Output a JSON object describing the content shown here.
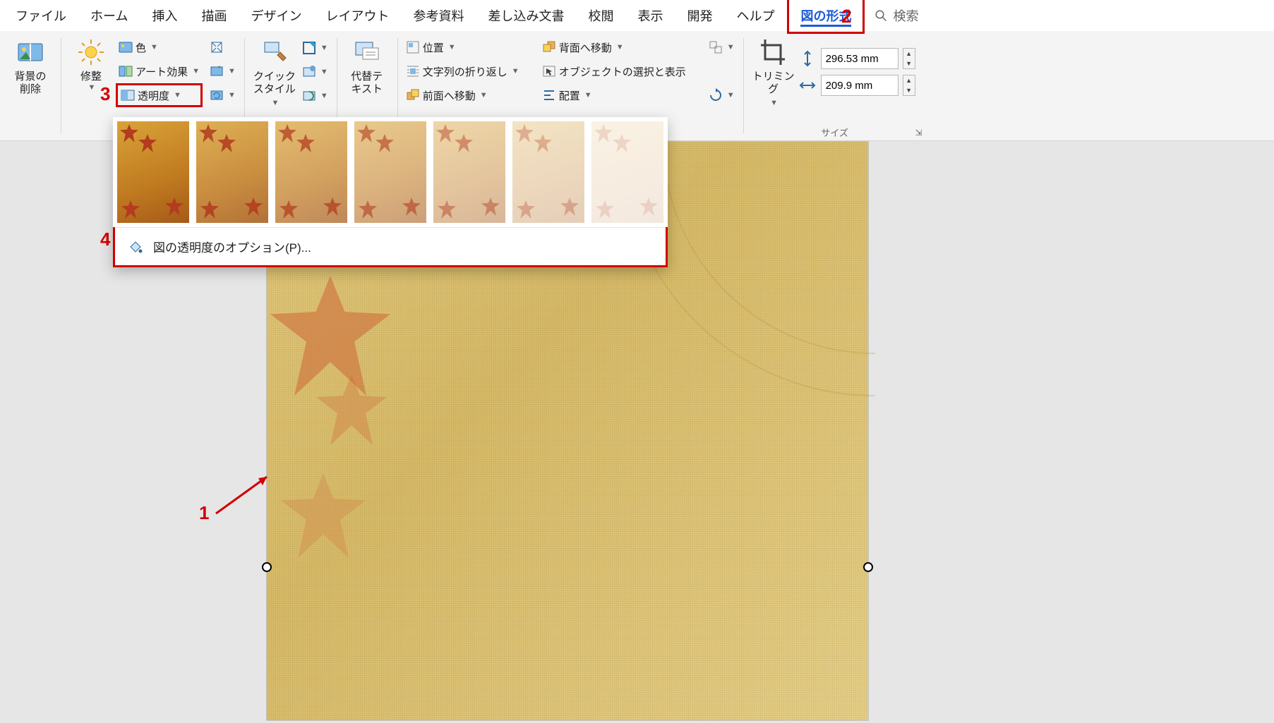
{
  "tabs": {
    "file": "ファイル",
    "home": "ホーム",
    "insert": "挿入",
    "draw": "描画",
    "design": "デザイン",
    "layout": "レイアウト",
    "references": "参考資料",
    "mailings": "差し込み文書",
    "review": "校閲",
    "view": "表示",
    "developer": "開発",
    "help": "ヘルプ",
    "picture_format": "図の形式",
    "search": "検索"
  },
  "ribbon": {
    "remove_bg_l1": "背景の",
    "remove_bg_l2": "削除",
    "corrections": "修整",
    "color": "色",
    "artistic": "アート効果",
    "transparency": "透明度",
    "quick_l1": "クイック",
    "quick_l2": "スタイル",
    "alt_l1": "代替テ",
    "alt_l2": "キスト",
    "position": "位置",
    "wrap": "文字列の折り返し",
    "bring_fwd": "前面へ移動",
    "send_back": "背面へ移動",
    "selection": "オブジェクトの選択と表示",
    "align": "配置",
    "crop": "トリミング",
    "height": "296.53 mm",
    "width": "209.9 mm",
    "size_label": "サイズ"
  },
  "popup": {
    "options_label": "図の透明度のオプション(P)..."
  },
  "annotations": {
    "n1": "1",
    "n2": "2",
    "n3": "3",
    "n4": "4"
  }
}
